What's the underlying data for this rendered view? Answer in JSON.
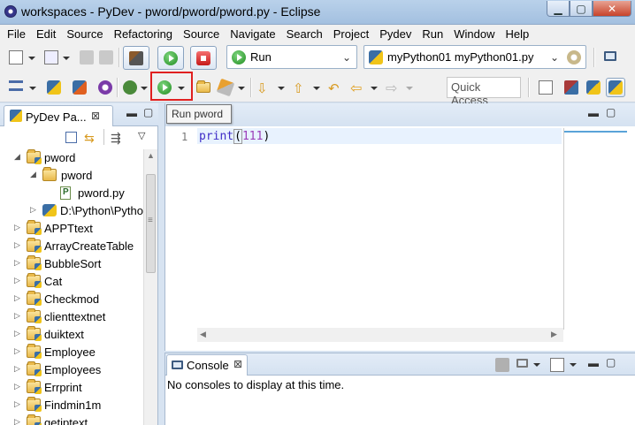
{
  "window": {
    "title": "workspaces - PyDev - pword/pword/pword.py - Eclipse",
    "min_glyph": "▁",
    "max_glyph": "▢",
    "close_glyph": "✕"
  },
  "menu": [
    "File",
    "Edit",
    "Source",
    "Refactoring",
    "Source",
    "Navigate",
    "Search",
    "Project",
    "Pydev",
    "Run",
    "Window",
    "Help"
  ],
  "toolbar": {
    "run_config_label": "Run",
    "launch_target_label": "myPython01 myPython01.py",
    "quick_access_label": "Quick Access",
    "tooltip": "Run pword"
  },
  "package_explorer": {
    "tab_label": "PyDev Pa...",
    "close_glyph": "⊠",
    "tree": [
      {
        "label": "pword",
        "level": 0,
        "expanded": true,
        "kind": "project"
      },
      {
        "label": "pword",
        "level": 1,
        "expanded": true,
        "kind": "folder"
      },
      {
        "label": "pword.py",
        "level": 2,
        "expanded": false,
        "kind": "pyfile"
      },
      {
        "label": "D:\\Python\\Pytho",
        "level": 1,
        "expanded": false,
        "kind": "pylib"
      },
      {
        "label": "APPTtext",
        "level": 0,
        "expanded": false,
        "kind": "project"
      },
      {
        "label": "ArrayCreateTable",
        "level": 0,
        "expanded": false,
        "kind": "project"
      },
      {
        "label": "BubbleSort",
        "level": 0,
        "expanded": false,
        "kind": "project"
      },
      {
        "label": "Cat",
        "level": 0,
        "expanded": false,
        "kind": "project"
      },
      {
        "label": "Checkmod",
        "level": 0,
        "expanded": false,
        "kind": "project"
      },
      {
        "label": "clienttextnet",
        "level": 0,
        "expanded": false,
        "kind": "project"
      },
      {
        "label": "duiktext",
        "level": 0,
        "expanded": false,
        "kind": "project"
      },
      {
        "label": "Employee",
        "level": 0,
        "expanded": false,
        "kind": "project"
      },
      {
        "label": "Employees",
        "level": 0,
        "expanded": false,
        "kind": "project"
      },
      {
        "label": "Errprint",
        "level": 0,
        "expanded": false,
        "kind": "project"
      },
      {
        "label": "Findmin1m",
        "level": 0,
        "expanded": false,
        "kind": "project"
      },
      {
        "label": "getiptext",
        "level": 0,
        "expanded": false,
        "kind": "project"
      }
    ]
  },
  "editor": {
    "line_number": "1",
    "code_func": "print",
    "code_open": "(",
    "code_arg": "111",
    "code_close": ")"
  },
  "console": {
    "tab_label": "Console",
    "close_glyph": "⊠",
    "message": "No consoles to display at this time."
  },
  "colors": {
    "run_green": "#1f8c1f",
    "stop_red": "#c51a1a",
    "highlight_red": "#e02020",
    "keyword_blue": "#3f2cc7",
    "number_purple": "#9b3cb8"
  }
}
